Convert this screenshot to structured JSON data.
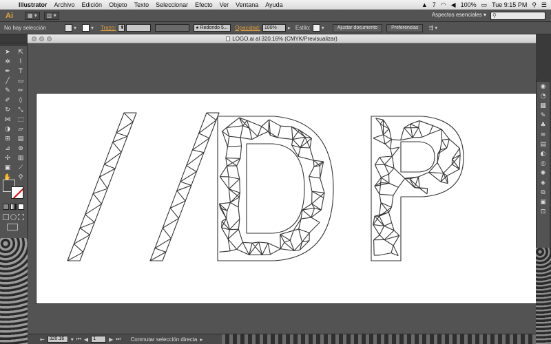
{
  "menubar": {
    "app_name": "Illustrator",
    "items": [
      "Archivo",
      "Edición",
      "Objeto",
      "Texto",
      "Seleccionar",
      "Efecto",
      "Ver",
      "Ventana",
      "Ayuda"
    ],
    "status_num": "7",
    "battery": "100%",
    "clock": "Tue 9:15 PM"
  },
  "appbar": {
    "logo": "Ai",
    "workspace": "Aspectos esenciales",
    "search_placeholder": ""
  },
  "controlbar": {
    "selection": "No hay selección",
    "stroke_label": "Trazo:",
    "brush_value": "Redondo 5...",
    "opacity_label": "Opacidad:",
    "opacity_value": "100%",
    "style_label": "Estilo:",
    "doc_setup": "Ajustar documento",
    "preferences": "Preferencias"
  },
  "document": {
    "title": "LOGO.ai al 320.16% (CMYK/Previsualizar)"
  },
  "statusbar": {
    "zoom": "320.16",
    "artboard": "1",
    "tool_hint": "Conmutar selección directa"
  },
  "icons": {
    "tools": [
      "selection-arrow",
      "direct-selection",
      "magic-wand",
      "lasso",
      "pen",
      "type",
      "line",
      "rectangle",
      "paintbrush",
      "pencil",
      "blob-brush",
      "eraser",
      "rotate",
      "scale",
      "width",
      "free-transform",
      "shape-builder",
      "perspective",
      "mesh",
      "gradient",
      "eyedropper",
      "blend",
      "symbol-sprayer",
      "column-graph",
      "artboard",
      "slice",
      "hand",
      "zoom"
    ],
    "right": [
      "color-guide",
      "color",
      "swatches",
      "brushes",
      "symbols",
      "stroke",
      "gradient",
      "transparency",
      "appearance",
      "graphic-styles",
      "layers",
      "artboards"
    ]
  },
  "colors": {
    "accent_orange": "#e8a33a",
    "panel": "#535353",
    "artboard": "#ffffff"
  }
}
